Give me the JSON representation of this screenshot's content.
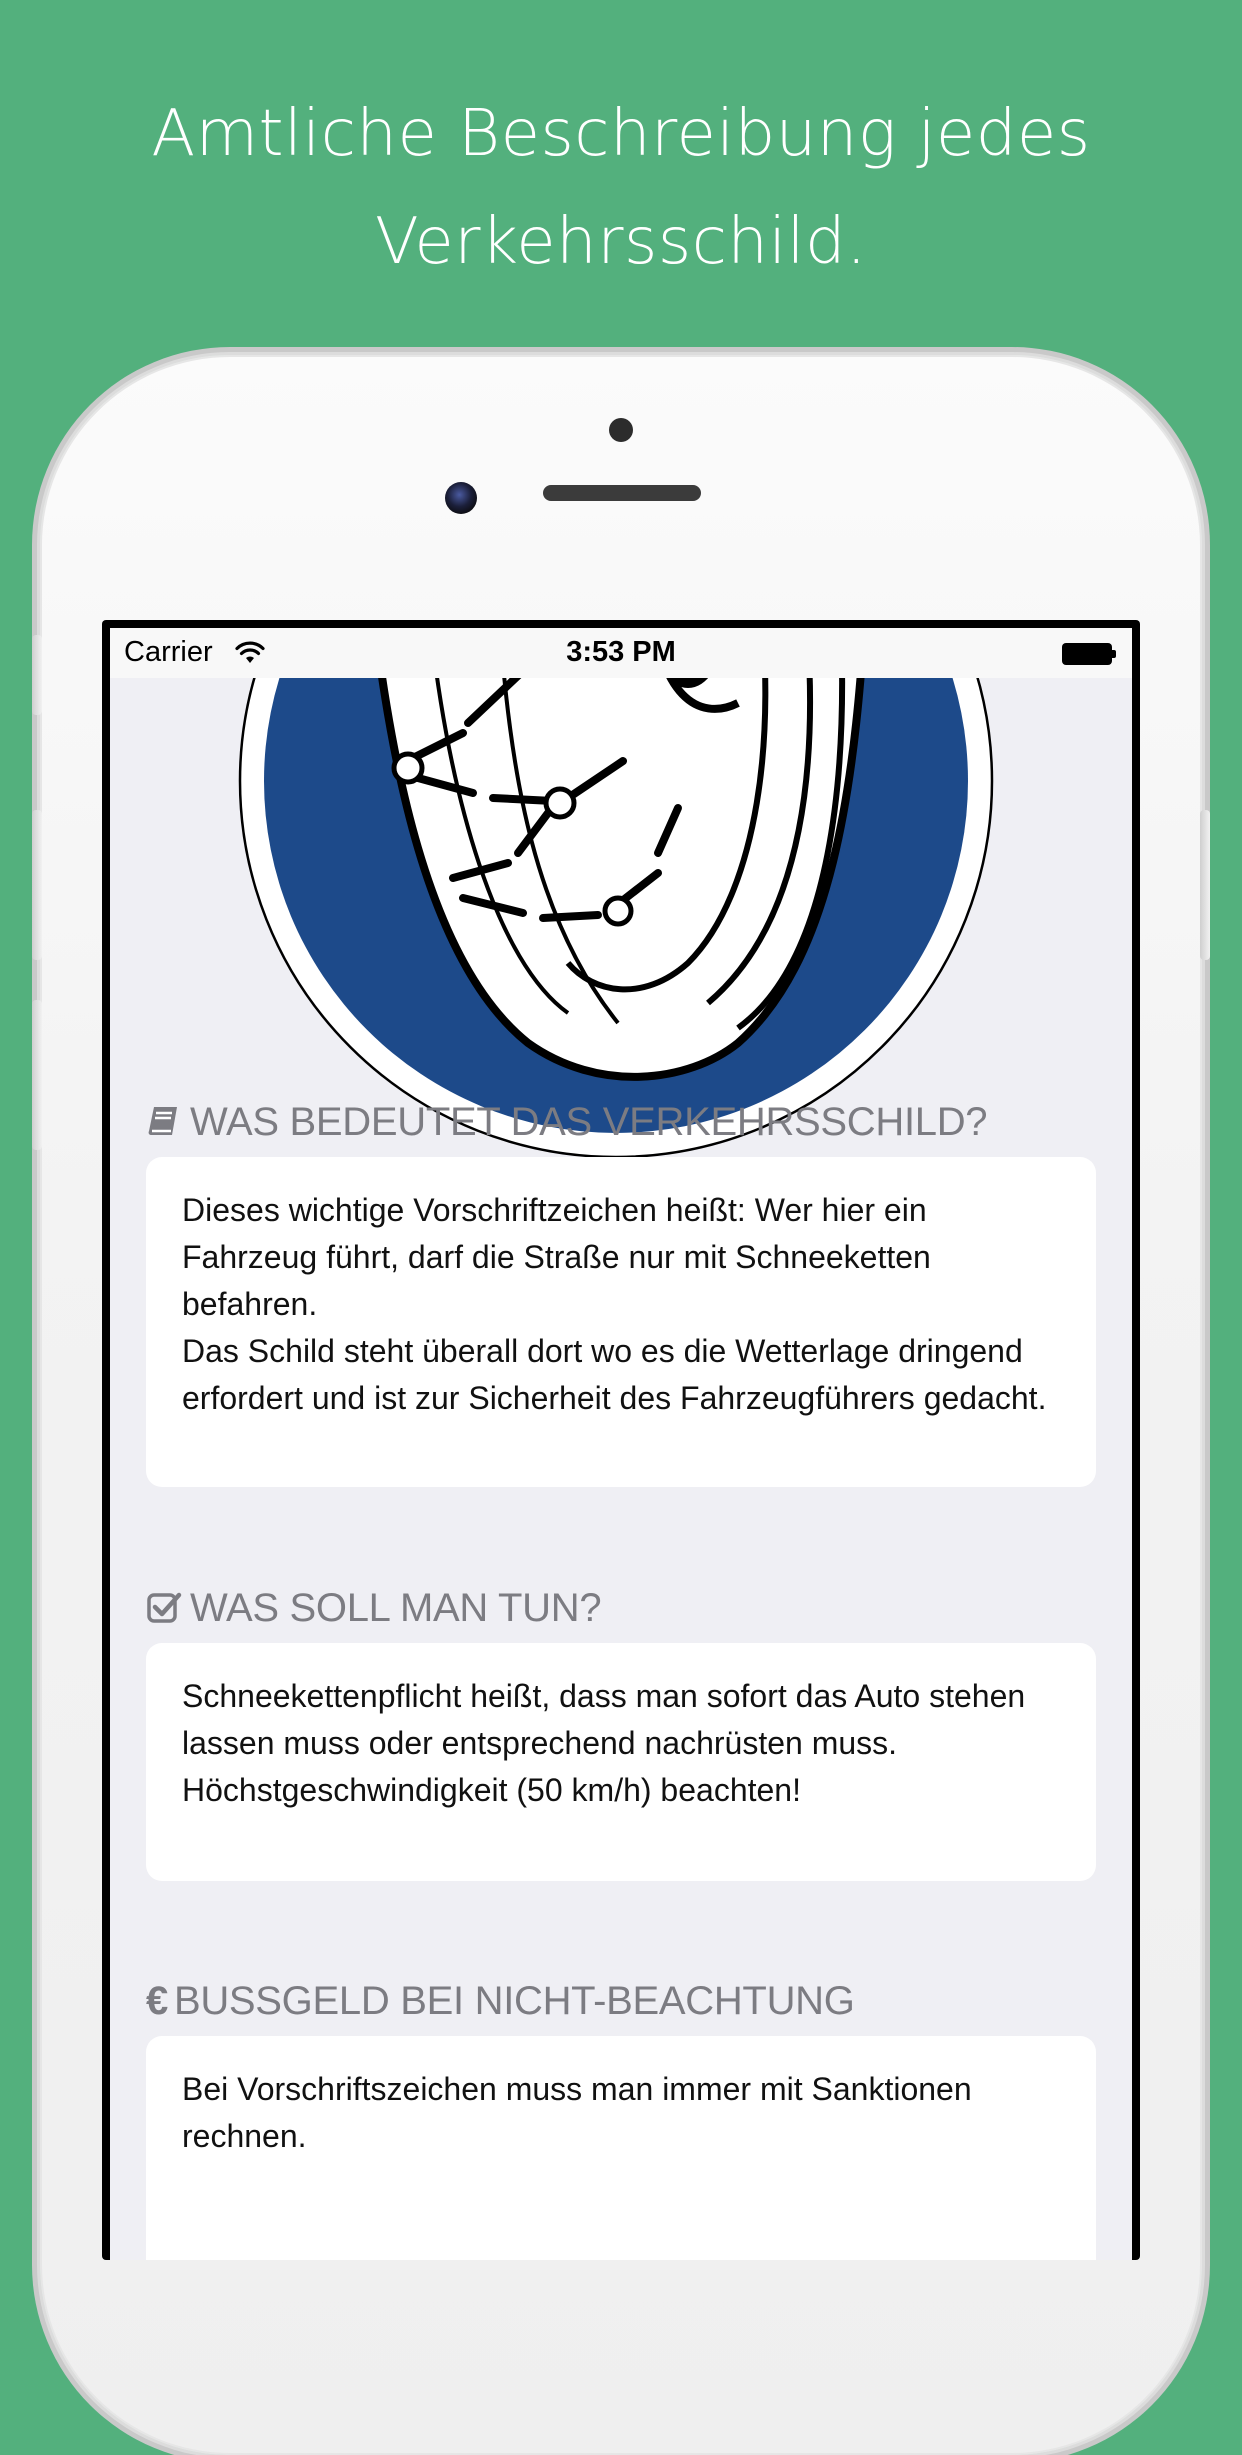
{
  "headline": "Amtliche Beschreibung jedes\nVerkehrsschild.",
  "colors": {
    "background": "#53B07D",
    "sign_blue": "#1D4A8A",
    "screen_background": "#EFEFF4",
    "section_header": "#7C7C82"
  },
  "statusbar": {
    "carrier": "Carrier",
    "time": "3:53 PM",
    "wifi_icon": "wifi-icon",
    "battery_icon": "battery-icon"
  },
  "sign": {
    "icon": "snow-chains-mandatory-sign"
  },
  "sections": [
    {
      "icon": "book-icon",
      "title": "WAS BEDEUTET DAS VERKEHRSSCHILD?",
      "paragraphs": [
        "Dieses wichtige Vorschriftzeichen heißt: Wer hier ein Fahrzeug führt, darf die Straße nur mit Schneeketten befahren.",
        "Das Schild steht überall dort wo es die Wetterlage dringend erfordert und ist zur Sicherheit des Fahrzeugführers gedacht."
      ]
    },
    {
      "icon": "checkbox-icon",
      "title": "WAS SOLL MAN TUN?",
      "paragraphs": [
        "Schneekettenpflicht heißt, dass man sofort das Auto stehen lassen muss oder entsprechend nachrüsten muss.",
        "Höchstgeschwindigkeit (50 km/h) beachten!"
      ]
    },
    {
      "icon": "euro-icon",
      "icon_glyph": "€",
      "title": "BUSSGELD BEI NICHT-BEACHTUNG",
      "paragraphs": [
        "Bei Vorschriftszeichen muss man immer mit Sanktionen rechnen."
      ]
    }
  ]
}
